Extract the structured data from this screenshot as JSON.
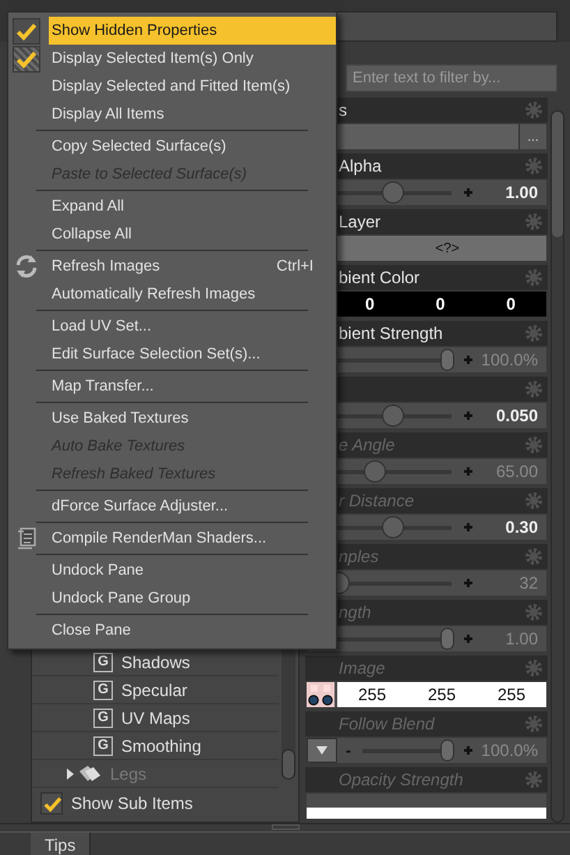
{
  "menu": {
    "items": [
      {
        "kind": "item",
        "label": "Show Hidden Properties",
        "checked": true,
        "selected": true,
        "disabled": false
      },
      {
        "kind": "item",
        "label": "Display Selected Item(s) Only",
        "checked": true,
        "selected": false,
        "disabled": false
      },
      {
        "kind": "item",
        "label": "Display Selected and Fitted Item(s)",
        "checked": false,
        "selected": false,
        "disabled": false
      },
      {
        "kind": "item",
        "label": "Display All Items",
        "checked": false,
        "selected": false,
        "disabled": false
      },
      {
        "kind": "separator"
      },
      {
        "kind": "item",
        "label": "Copy Selected Surface(s)",
        "checked": false,
        "selected": false,
        "disabled": false
      },
      {
        "kind": "item",
        "label": "Paste to Selected Surface(s)",
        "checked": false,
        "selected": false,
        "disabled": true
      },
      {
        "kind": "separator"
      },
      {
        "kind": "item",
        "label": "Expand All",
        "checked": false,
        "selected": false,
        "disabled": false
      },
      {
        "kind": "item",
        "label": "Collapse All",
        "checked": false,
        "selected": false,
        "disabled": false
      },
      {
        "kind": "separator"
      },
      {
        "kind": "refresh",
        "label": "Refresh Images",
        "shortcut": "Ctrl+I",
        "checked": false,
        "selected": false,
        "disabled": false
      },
      {
        "kind": "item",
        "label": "Automatically Refresh Images",
        "checked": false,
        "selected": false,
        "disabled": false
      },
      {
        "kind": "separator"
      },
      {
        "kind": "item",
        "label": "Load UV Set...",
        "checked": false,
        "selected": false,
        "disabled": false
      },
      {
        "kind": "item",
        "label": "Edit Surface Selection Set(s)...",
        "checked": false,
        "selected": false,
        "disabled": false
      },
      {
        "kind": "separator"
      },
      {
        "kind": "item",
        "label": "Map Transfer...",
        "checked": false,
        "selected": false,
        "disabled": false
      },
      {
        "kind": "separator"
      },
      {
        "kind": "item",
        "label": "Use Baked Textures",
        "checked": false,
        "selected": false,
        "disabled": false
      },
      {
        "kind": "item",
        "label": "Auto Bake Textures",
        "checked": false,
        "selected": false,
        "disabled": true
      },
      {
        "kind": "item",
        "label": "Refresh Baked Textures",
        "checked": false,
        "selected": false,
        "disabled": true
      },
      {
        "kind": "separator"
      },
      {
        "kind": "item",
        "label": "dForce Surface Adjuster...",
        "checked": false,
        "selected": false,
        "disabled": false
      },
      {
        "kind": "separator"
      },
      {
        "kind": "shader",
        "label": "Compile RenderMan Shaders...",
        "checked": false,
        "selected": false,
        "disabled": false
      },
      {
        "kind": "separator"
      },
      {
        "kind": "item",
        "label": "Undock Pane",
        "checked": false,
        "selected": false,
        "disabled": false
      },
      {
        "kind": "item",
        "label": "Undock Pane Group",
        "checked": false,
        "selected": false,
        "disabled": false
      },
      {
        "kind": "separator"
      },
      {
        "kind": "item",
        "label": "Close Pane",
        "checked": false,
        "selected": false,
        "disabled": false
      }
    ]
  },
  "filter": {
    "placeholder": "Enter text to filter by..."
  },
  "properties": [
    {
      "label": "s",
      "hidden": false,
      "kind": "browse",
      "button": "..."
    },
    {
      "label": "Alpha",
      "hidden": false,
      "kind": "slider",
      "level": 0.56,
      "value": "1.00",
      "modified": true
    },
    {
      "label": "Layer",
      "hidden": false,
      "kind": "button",
      "value": "<?>"
    },
    {
      "label": "bient Color",
      "hidden": false,
      "kind": "color",
      "values": [
        "0",
        "0",
        "0"
      ]
    },
    {
      "label": "bient Strength",
      "hidden": false,
      "kind": "slider",
      "level": 1,
      "value": "100.0%",
      "modified": false
    },
    {
      "kind": "slider",
      "level": 0.56,
      "value": "0.050",
      "modified": true
    },
    {
      "label": "e Angle",
      "hidden": true,
      "kind": "slider",
      "level": 0.43,
      "value": "65.00",
      "modified": false
    },
    {
      "label": "r Distance",
      "hidden": true,
      "kind": "slider",
      "level": 0.56,
      "value": "0.30",
      "modified": true
    },
    {
      "label": "nples",
      "hidden": true,
      "kind": "slider",
      "level": 0.16,
      "value": "32",
      "modified": false
    },
    {
      "label": "ngth",
      "hidden": true,
      "kind": "slider",
      "level": 1,
      "value": "1.00",
      "modified": false
    },
    {
      "label": "Image",
      "hidden": true,
      "kind": "image",
      "values": [
        "255",
        "255",
        "255"
      ]
    },
    {
      "label": "Follow Blend",
      "hidden": true,
      "kind": "dropdown-slider",
      "minus": "-",
      "level": 1,
      "value": "100.0%",
      "modified": false
    },
    {
      "label": "Opacity Strength",
      "hidden": true,
      "kind": "bar"
    }
  ],
  "tree": {
    "items": [
      {
        "kind": "group",
        "badge": "G",
        "label": "Shadows"
      },
      {
        "kind": "group",
        "badge": "G",
        "label": "Specular"
      },
      {
        "kind": "group",
        "badge": "G",
        "label": "UV Maps"
      },
      {
        "kind": "group",
        "badge": "G",
        "label": "Smoothing"
      },
      {
        "kind": "node",
        "label": "Legs",
        "expanded": false,
        "disabled": true
      }
    ]
  },
  "show_sub_items": {
    "label": "Show Sub Items",
    "checked": true
  },
  "tabs": [
    {
      "label": "Tips",
      "selected": true
    }
  ]
}
